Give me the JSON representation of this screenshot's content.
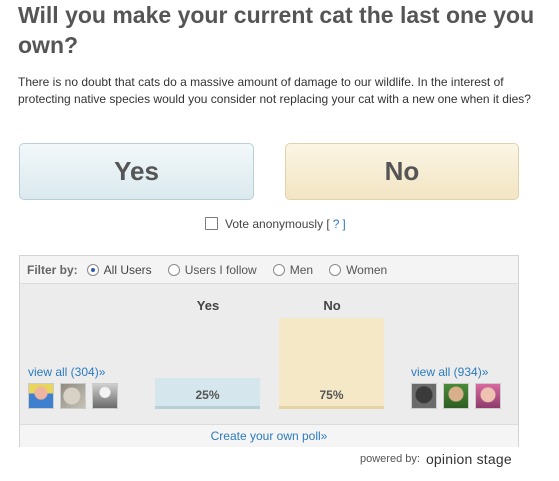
{
  "poll": {
    "title": "Will you make your current cat the last one you own?",
    "description": "There is no doubt that cats do a massive amount of damage to our wildlife. In the interest of protecting native species would you consider not replacing your cat with a new one when it dies?"
  },
  "vote": {
    "yes_label": "Yes",
    "no_label": "No",
    "anonymous_label": "Vote anonymously [",
    "anonymous_help": "?",
    "anonymous_close": "]"
  },
  "filter": {
    "label": "Filter by:",
    "options": [
      "All Users",
      "Users I follow",
      "Men",
      "Women"
    ],
    "selected": "All Users"
  },
  "results": {
    "yes_header": "Yes",
    "no_header": "No",
    "yes_percent": "25%",
    "no_percent": "75%",
    "yes_view_all": "view all (304)»",
    "no_view_all": "view all (934)»"
  },
  "footer": {
    "create_poll": "Create your own poll»",
    "powered_by": "powered by:",
    "logo": "opinion stage"
  },
  "colors": {
    "yes": "#d5e6ec",
    "no": "#f5e8c7",
    "link": "#2b7bbf"
  }
}
